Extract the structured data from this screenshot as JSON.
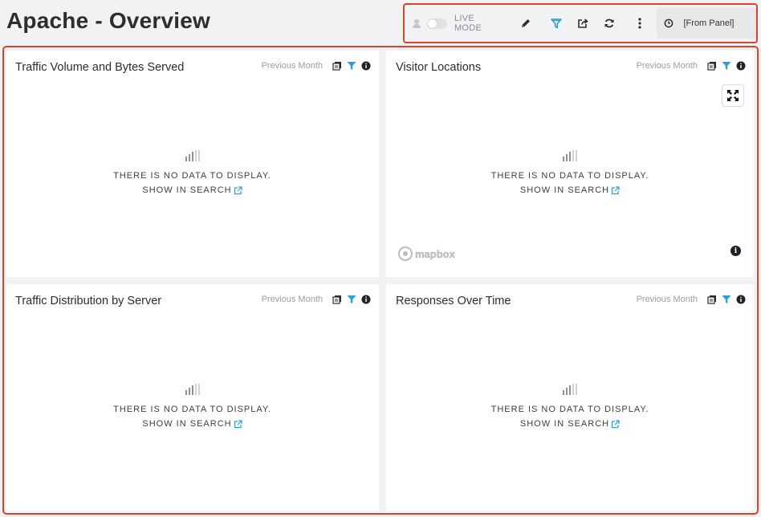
{
  "header": {
    "title": "Apache - Overview"
  },
  "toolbar": {
    "live_mode_label": "LIVE MODE",
    "live_mode_on": false,
    "time_range": "[From Panel]",
    "icons": [
      "user-icon",
      "pencil-icon",
      "filter-icon",
      "share-icon",
      "refresh-icon",
      "more-vertical-icon",
      "clock-icon"
    ],
    "accent_color": "#2a9fd8"
  },
  "panels": [
    {
      "title": "Traffic Volume and Bytes Served",
      "range": "Previous Month",
      "empty_text": "THERE IS NO DATA TO DISPLAY.",
      "link_text": "SHOW IN SEARCH"
    },
    {
      "title": "Visitor Locations",
      "range": "Previous Month",
      "empty_text": "THERE IS NO DATA TO DISPLAY.",
      "link_text": "SHOW IN SEARCH",
      "map_logo": "mapbox"
    },
    {
      "title": "Traffic Distribution by Server",
      "range": "Previous Month",
      "empty_text": "THERE IS NO DATA TO DISPLAY.",
      "link_text": "SHOW IN SEARCH"
    },
    {
      "title": "Responses Over Time",
      "range": "Previous Month",
      "empty_text": "THERE IS NO DATA TO DISPLAY.",
      "link_text": "SHOW IN SEARCH"
    }
  ],
  "colors": {
    "highlight_border": "#e0402c",
    "link_icon": "#2a9fd8",
    "filter_icon": "#2a9fd8"
  }
}
